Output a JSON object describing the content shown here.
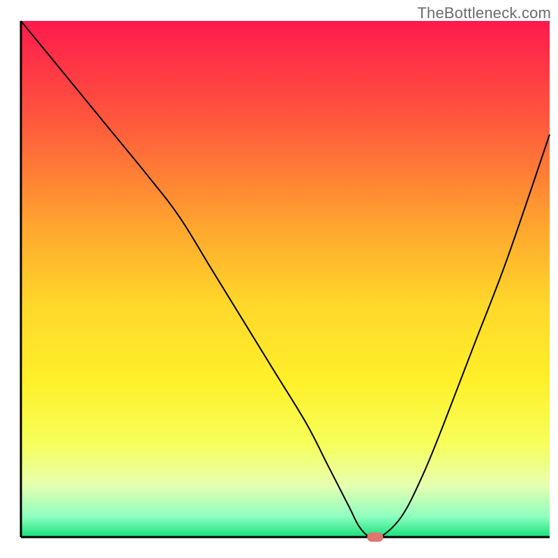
{
  "watermark": "TheBottleneck.com",
  "chart_data": {
    "type": "line",
    "title": "",
    "xlabel": "",
    "ylabel": "",
    "xlim": [
      0,
      100
    ],
    "ylim": [
      0,
      100
    ],
    "grid": false,
    "axes_visible": {
      "x": true,
      "y": true,
      "top": false,
      "right": false
    },
    "gradient_background": {
      "stops": [
        {
          "offset": 0.0,
          "color": "#ff1a4d"
        },
        {
          "offset": 0.2,
          "color": "#ff5a3c"
        },
        {
          "offset": 0.4,
          "color": "#ffa62e"
        },
        {
          "offset": 0.55,
          "color": "#ffd82a"
        },
        {
          "offset": 0.7,
          "color": "#fff02a"
        },
        {
          "offset": 0.82,
          "color": "#f6ff5a"
        },
        {
          "offset": 0.9,
          "color": "#e6ffb0"
        },
        {
          "offset": 0.96,
          "color": "#8effc0"
        },
        {
          "offset": 1.0,
          "color": "#18e07a"
        }
      ]
    },
    "series": [
      {
        "name": "bottleneck-curve",
        "stroke": "#000000",
        "stroke_width": 2,
        "x": [
          0,
          8,
          16,
          24,
          30,
          36,
          42,
          48,
          54,
          58,
          62,
          64,
          66,
          68,
          72,
          76,
          80,
          86,
          92,
          100
        ],
        "y": [
          100,
          90,
          80,
          70,
          62,
          52,
          42,
          32,
          22,
          14,
          6,
          2,
          0,
          0,
          4,
          12,
          22,
          38,
          54,
          78
        ]
      }
    ],
    "marker": {
      "name": "optimal-point",
      "x": 67,
      "y": 0,
      "shape": "rounded-rect",
      "color": "#e0746e",
      "width_pct": 3.0,
      "height_pct": 1.8
    }
  }
}
